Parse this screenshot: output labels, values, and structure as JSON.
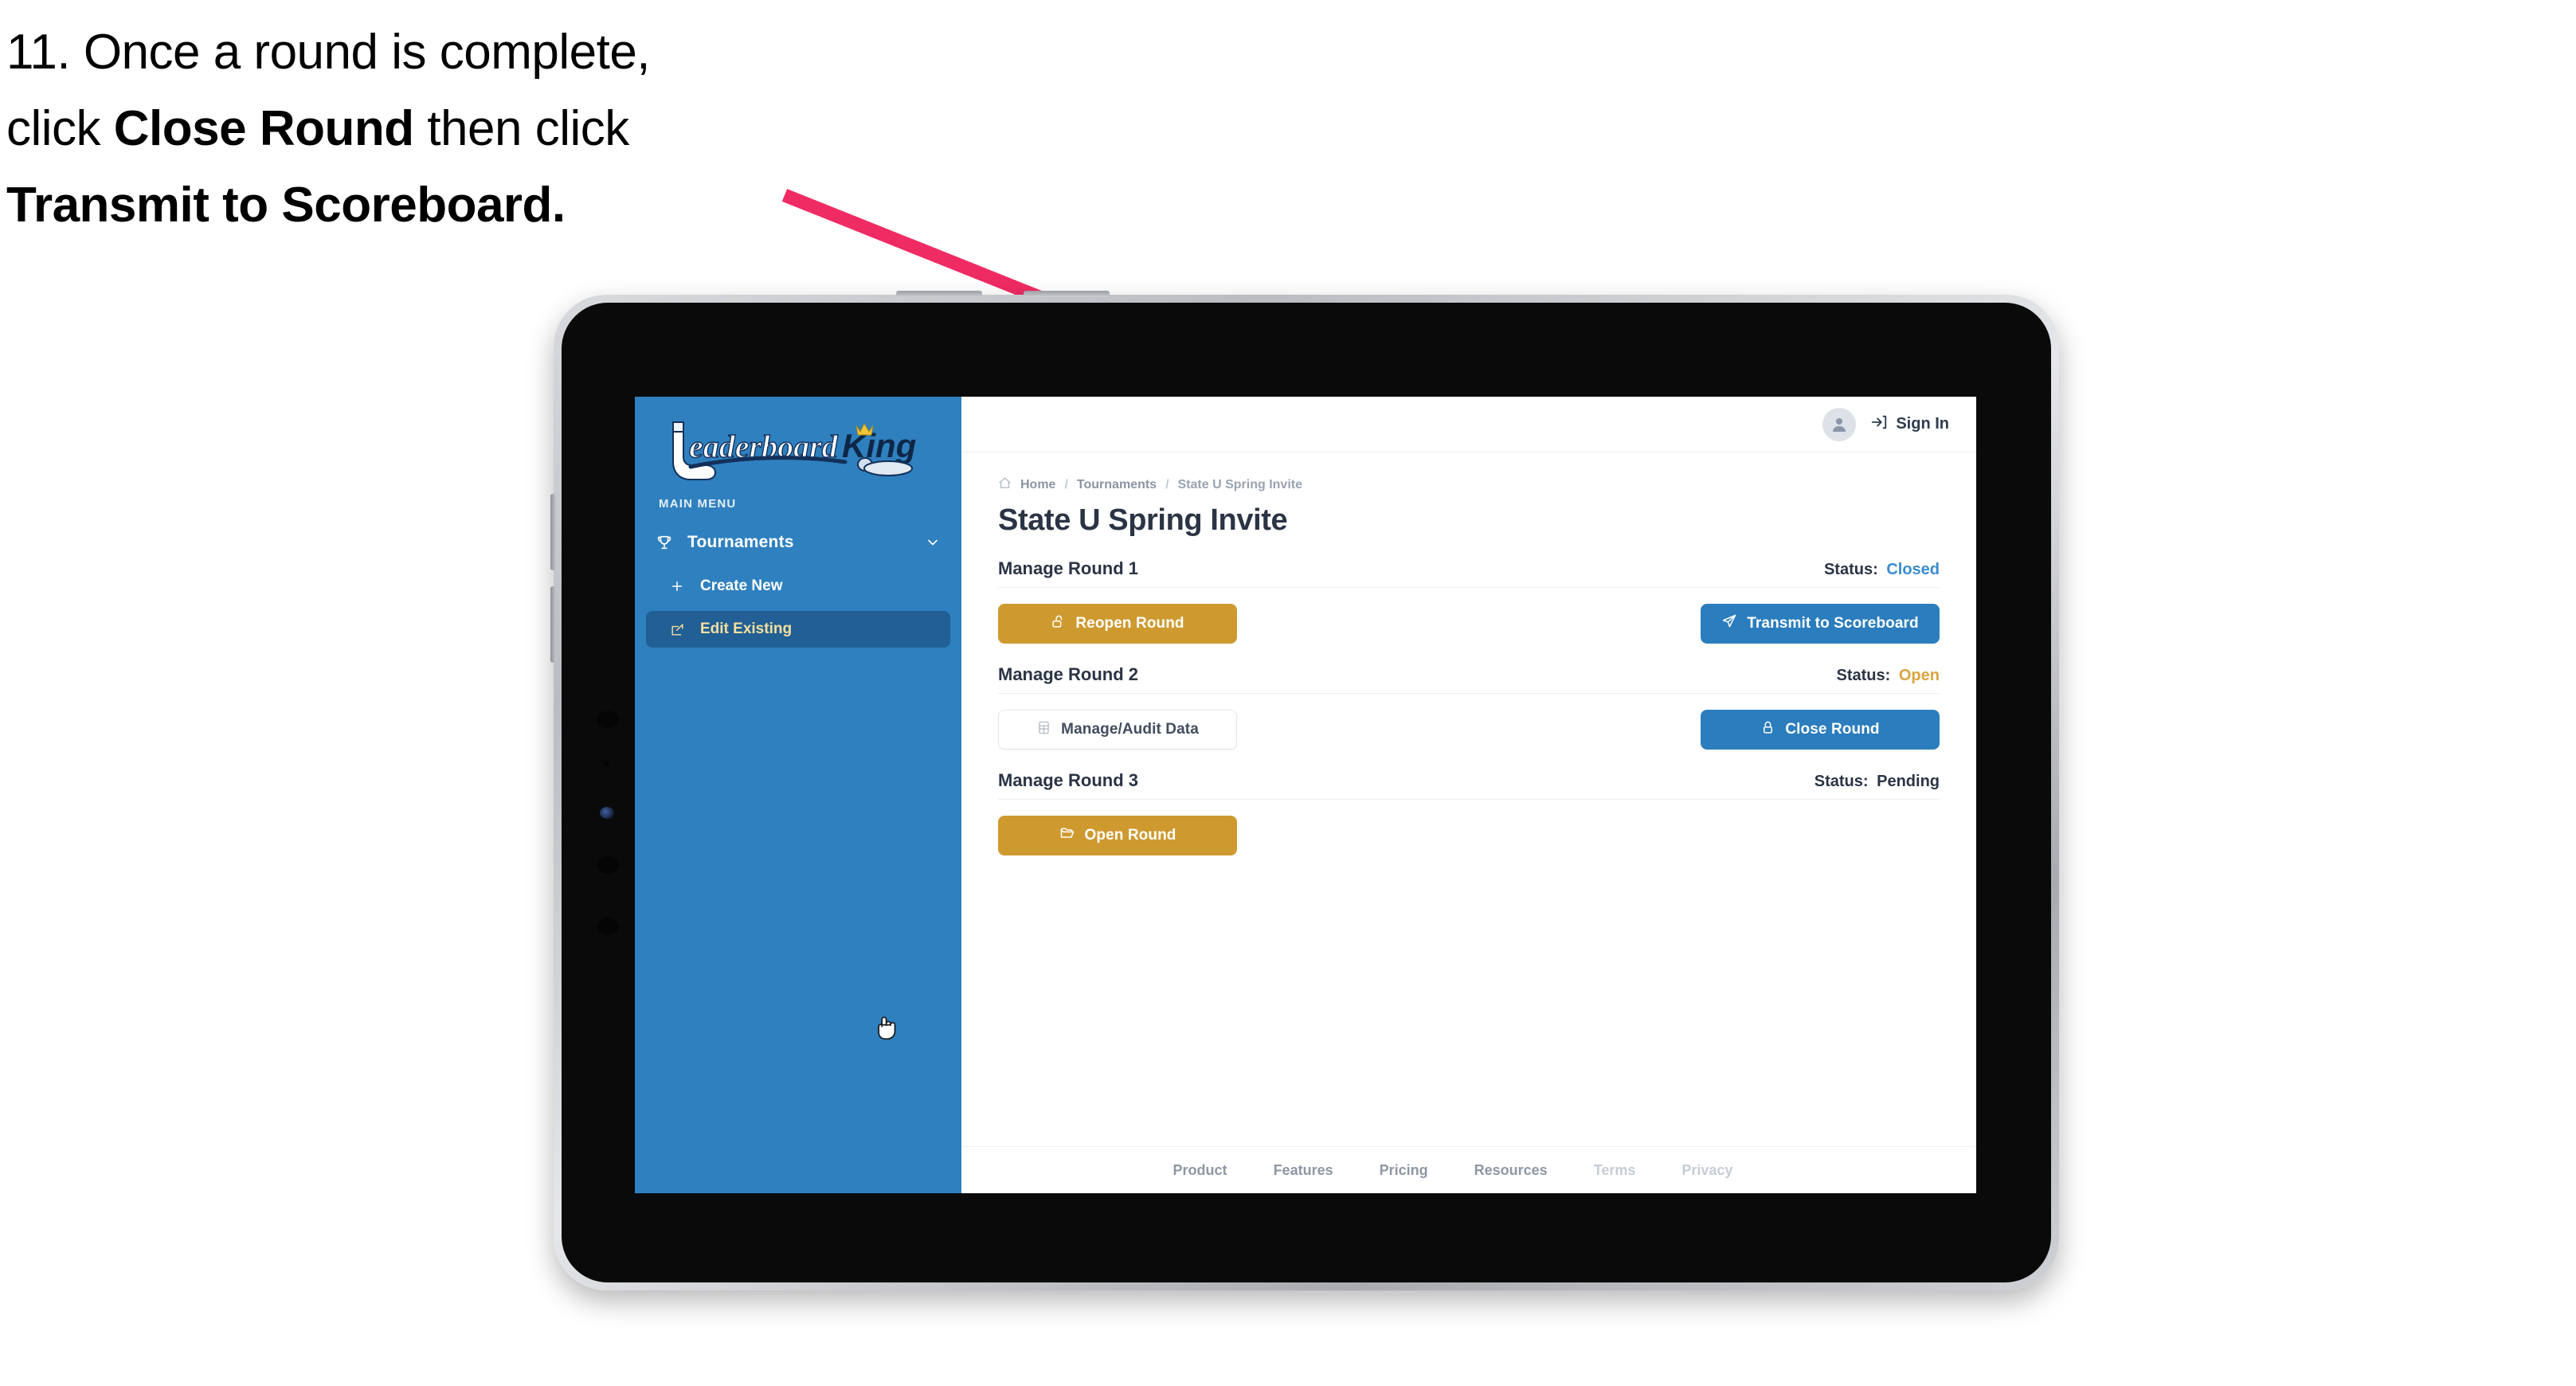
{
  "caption": {
    "line1_prefix": "11. Once a round is complete,",
    "line2_prefix": "click ",
    "line2_bold": "Close Round",
    "line2_suffix": " then click",
    "line3_bold": "Transmit to Scoreboard."
  },
  "annotation": {
    "arrow_color": "#ef2b63"
  },
  "sidebar": {
    "logo_text_primary": "Leaderboard",
    "logo_text_secondary": "King",
    "menu_label": "MAIN MENU",
    "items": [
      {
        "label": "Tournaments",
        "icon": "trophy-icon",
        "expanded": true
      },
      {
        "label": "Create New",
        "icon": "plus-icon",
        "active": false
      },
      {
        "label": "Edit Existing",
        "icon": "edit-square-icon",
        "active": true
      }
    ],
    "colors": {
      "background": "#2f80bf",
      "active_background": "#215f94",
      "active_text": "#f5dfa0"
    }
  },
  "topbar": {
    "avatar_icon": "user-avatar-icon",
    "signin_icon": "login-arrow-icon",
    "signin_label": "Sign In"
  },
  "breadcrumb": {
    "home_icon": "home-icon",
    "items": [
      "Home",
      "Tournaments",
      "State U Spring Invite"
    ],
    "separator": "/"
  },
  "page": {
    "title": "State U Spring Invite"
  },
  "rounds": [
    {
      "name": "Manage Round 1",
      "status_label": "Status:",
      "status_value": "Closed",
      "status_color": "#3a8bd0",
      "left_button": {
        "label": "Reopen Round",
        "icon": "unlock-icon",
        "style": "amber"
      },
      "right_button": {
        "label": "Transmit to Scoreboard",
        "icon": "send-plane-icon",
        "style": "blue"
      }
    },
    {
      "name": "Manage Round 2",
      "status_label": "Status:",
      "status_value": "Open",
      "status_color": "#d9a441",
      "left_button": {
        "label": "Manage/Audit Data",
        "icon": "table-grid-icon",
        "style": "ghost"
      },
      "right_button": {
        "label": "Close Round",
        "icon": "lock-icon",
        "style": "blue"
      }
    },
    {
      "name": "Manage Round 3",
      "status_label": "Status:",
      "status_value": "Pending",
      "status_color": "#2b3445",
      "left_button": {
        "label": "Open Round",
        "icon": "folder-open-icon",
        "style": "amber"
      },
      "right_button": null
    }
  ],
  "footer": {
    "links": [
      "Product",
      "Features",
      "Pricing",
      "Resources",
      "Terms",
      "Privacy"
    ]
  }
}
